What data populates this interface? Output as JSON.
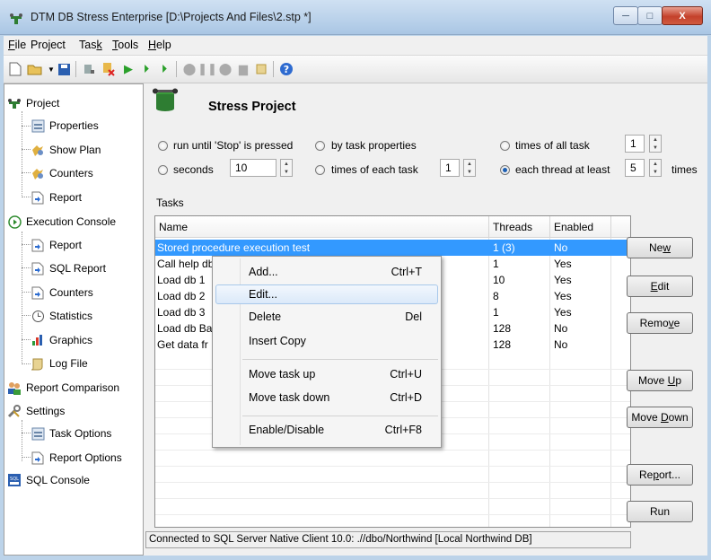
{
  "window": {
    "title": "DTM DB Stress Enterprise [D:\\Projects And Files\\2.stp *]",
    "controls": {
      "minimize": "─",
      "maximize": "□",
      "close": "X"
    }
  },
  "menubar": [
    {
      "label": "File",
      "u": "F",
      "rest": "ile"
    },
    {
      "label": "Project",
      "u": "",
      "rest": "Project"
    },
    {
      "label": "Task",
      "u": "k",
      "pre": "Tas"
    },
    {
      "label": "Tools",
      "u": "T",
      "rest": "ools"
    },
    {
      "label": "Help",
      "u": "H",
      "rest": "elp"
    }
  ],
  "tree": {
    "project": "Project",
    "properties": "Properties",
    "show_plan": "Show Plan",
    "counters": "Counters",
    "report": "Report",
    "execution_console": "Execution Console",
    "exec_report": "Report",
    "sql_report": "SQL Report",
    "exec_counters": "Counters",
    "statistics": "Statistics",
    "graphics": "Graphics",
    "log_file": "Log File",
    "report_comparison": "Report Comparison",
    "settings": "Settings",
    "task_options": "Task Options",
    "report_options": "Report Options",
    "sql_console": "SQL Console"
  },
  "header": {
    "title": "Stress Project"
  },
  "options": {
    "run_until_stop": "run until 'Stop' is pressed",
    "by_task_properties": "by task properties",
    "times_of_all_task": "times of all task",
    "times_of_all_task_value": "1",
    "seconds": "seconds",
    "seconds_value": "10",
    "times_of_each_task": "times of each task",
    "times_of_each_task_value": "1",
    "each_thread_at_least": "each thread at least",
    "each_thread_value": "5",
    "times": "times",
    "selected": "each_thread_at_least"
  },
  "tasks": {
    "label": "Tasks",
    "columns": {
      "name": "Name",
      "threads": "Threads",
      "enabled": "Enabled"
    },
    "rows": [
      {
        "name": "Stored procedure execution test",
        "threads": "1 (3)",
        "enabled": "No"
      },
      {
        "name": "Call help db",
        "threads": "1",
        "enabled": "Yes"
      },
      {
        "name": "Load db 1",
        "threads": "10",
        "enabled": "Yes"
      },
      {
        "name": "Load db 2",
        "threads": "8",
        "enabled": "Yes"
      },
      {
        "name": "Load db 3",
        "threads": "1",
        "enabled": "Yes"
      },
      {
        "name": "Load db Ba",
        "threads": "128",
        "enabled": "No"
      },
      {
        "name": "Get data fr",
        "threads": "128",
        "enabled": "No"
      }
    ]
  },
  "buttons": {
    "new": "New",
    "edit": "Edit",
    "remove": "Remove",
    "move_up": "Move Up",
    "move_down": "Move Down",
    "report": "Report...",
    "run": "Run"
  },
  "status": "Connected to SQL Server Native Client 10.0: .//dbo/Northwind [Local Northwind DB]",
  "context_menu": {
    "add": "Add...",
    "add_sc": "Ctrl+T",
    "edit": "Edit...",
    "delete": "Delete",
    "delete_sc": "Del",
    "insert_copy": "Insert Copy",
    "move_up": "Move task up",
    "move_up_sc": "Ctrl+U",
    "move_down": "Move task down",
    "move_down_sc": "Ctrl+D",
    "enable_disable": "Enable/Disable",
    "enable_disable_sc": "Ctrl+F8"
  },
  "colors": {
    "selection": "#3399ff",
    "titlebar": "#b9d1ea",
    "close": "#c4412b"
  }
}
